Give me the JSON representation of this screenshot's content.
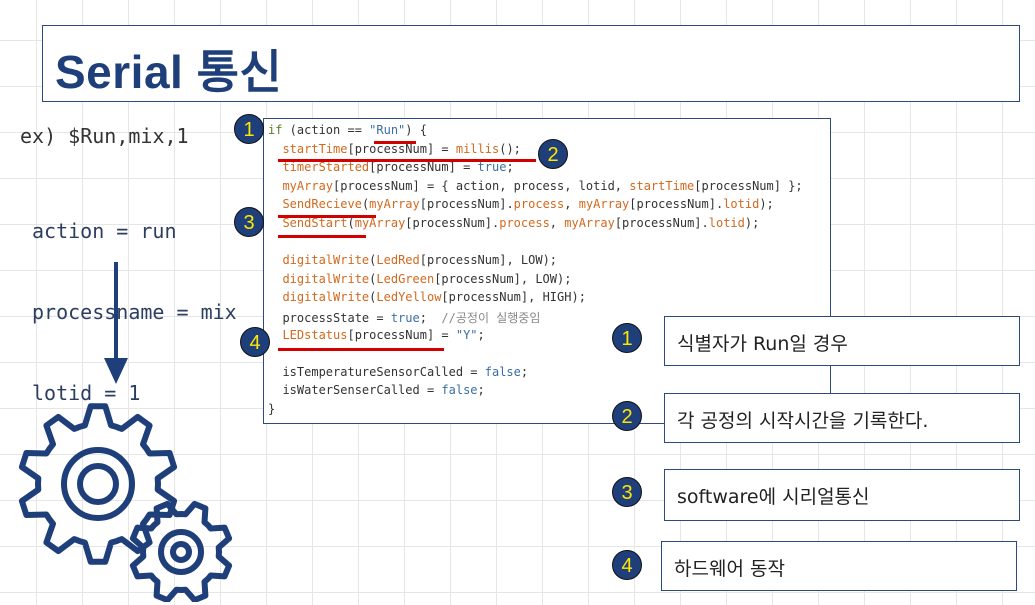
{
  "title": "Serial 통신",
  "example": "ex) $Run,mix,1",
  "params": [
    "action = run",
    "processname = mix",
    "lotid = 1"
  ],
  "code": {
    "lines": [
      [
        [
          "kw",
          "if"
        ],
        [
          "p",
          " (action == "
        ],
        [
          "str",
          "\"Run\""
        ],
        [
          "p",
          ") {"
        ]
      ],
      [
        [
          "p",
          "  "
        ],
        [
          "fn",
          "startTime"
        ],
        [
          "p",
          "[processNum] = "
        ],
        [
          "fn",
          "millis"
        ],
        [
          "p",
          "();"
        ]
      ],
      [
        [
          "p",
          "  "
        ],
        [
          "fn",
          "timerStarted"
        ],
        [
          "p",
          "[processNum] = "
        ],
        [
          "lit",
          "true"
        ],
        [
          "p",
          ";"
        ]
      ],
      [
        [
          "p",
          "  "
        ],
        [
          "fn",
          "myArray"
        ],
        [
          "p",
          "[processNum] = { action, process, lotid, "
        ],
        [
          "fn",
          "startTime"
        ],
        [
          "p",
          "[processNum] };"
        ]
      ],
      [
        [
          "p",
          "  "
        ],
        [
          "fn",
          "SendRecieve"
        ],
        [
          "p",
          "("
        ],
        [
          "fn",
          "myArray"
        ],
        [
          "p",
          "[processNum]."
        ],
        [
          "fn",
          "process"
        ],
        [
          "p",
          ", "
        ],
        [
          "fn",
          "myArray"
        ],
        [
          "p",
          "[processNum]."
        ],
        [
          "fn",
          "lotid"
        ],
        [
          "p",
          ");"
        ]
      ],
      [
        [
          "p",
          "  "
        ],
        [
          "fn",
          "SendStart"
        ],
        [
          "p",
          "("
        ],
        [
          "fn",
          "myArray"
        ],
        [
          "p",
          "[processNum]."
        ],
        [
          "fn",
          "process"
        ],
        [
          "p",
          ", "
        ],
        [
          "fn",
          "myArray"
        ],
        [
          "p",
          "[processNum]."
        ],
        [
          "fn",
          "lotid"
        ],
        [
          "p",
          ");"
        ]
      ],
      [
        [
          "p",
          ""
        ]
      ],
      [
        [
          "p",
          "  "
        ],
        [
          "fn",
          "digitalWrite"
        ],
        [
          "p",
          "("
        ],
        [
          "fn",
          "LedRed"
        ],
        [
          "p",
          "[processNum], LOW);"
        ]
      ],
      [
        [
          "p",
          "  "
        ],
        [
          "fn",
          "digitalWrite"
        ],
        [
          "p",
          "("
        ],
        [
          "fn",
          "LedGreen"
        ],
        [
          "p",
          "[processNum], LOW);"
        ]
      ],
      [
        [
          "p",
          "  "
        ],
        [
          "fn",
          "digitalWrite"
        ],
        [
          "p",
          "("
        ],
        [
          "fn",
          "LedYellow"
        ],
        [
          "p",
          "[processNum], HIGH);"
        ]
      ],
      [
        [
          "p",
          "  processState = "
        ],
        [
          "lit",
          "true"
        ],
        [
          "p",
          ";  "
        ],
        [
          "cm",
          "//공정이 실행중임"
        ]
      ],
      [
        [
          "p",
          "  "
        ],
        [
          "fn",
          "LEDstatus"
        ],
        [
          "p",
          "[processNum] = "
        ],
        [
          "str",
          "\"Y\""
        ],
        [
          "p",
          ";"
        ]
      ],
      [
        [
          "p",
          ""
        ]
      ],
      [
        [
          "p",
          "  isTemperatureSensorCalled = "
        ],
        [
          "lit",
          "false"
        ],
        [
          "p",
          ";"
        ]
      ],
      [
        [
          "p",
          "  isWaterSenserCalled = "
        ],
        [
          "lit",
          "false"
        ],
        [
          "p",
          ";"
        ]
      ],
      [
        [
          "p",
          "}"
        ]
      ]
    ]
  },
  "badges": [
    "1",
    "2",
    "3",
    "4"
  ],
  "descriptions": [
    {
      "num": "1",
      "text": "식별자가 Run일 경우"
    },
    {
      "num": "2",
      "text": "각 공정의 시작시간을 기록한다."
    },
    {
      "num": "3",
      "text": "software에 시리얼통신"
    },
    {
      "num": "4",
      "text": "하드웨어 동작"
    }
  ],
  "colors": {
    "accent": "#1f3f7a",
    "badge_text": "#ffe600",
    "underline": "#d40000"
  }
}
